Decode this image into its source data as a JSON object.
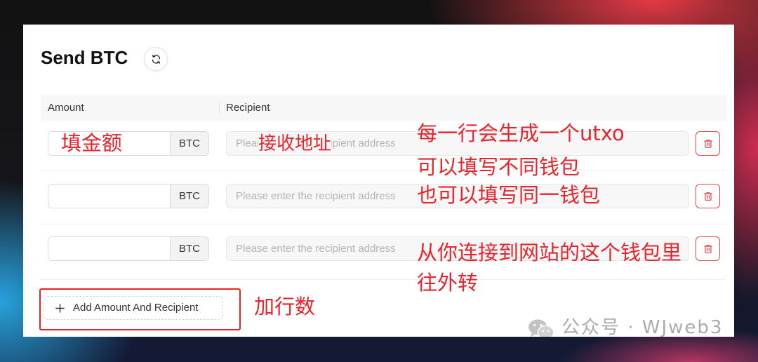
{
  "header": {
    "title": "Send BTC",
    "refresh_icon": "refresh-icon"
  },
  "table": {
    "columns": {
      "amount": "Amount",
      "recipient": "Recipient"
    },
    "rows": [
      {
        "currency": "BTC",
        "recipient_placeholder": "Please enter the recipient address"
      },
      {
        "currency": "BTC",
        "recipient_placeholder": "Please enter the recipient address"
      },
      {
        "currency": "BTC",
        "recipient_placeholder": "Please enter the recipient address"
      }
    ],
    "delete_icon": "trash-icon"
  },
  "add_button": {
    "label": "Add Amount And Recipient",
    "icon": "plus-icon"
  },
  "annotations": {
    "amount": "填金额",
    "recipient": "接收地址",
    "note_line1": "每一行会生成一个utxo",
    "note_line2": "可以填写不同钱包",
    "note_line3": "也可以填写同一钱包",
    "source_line1": "从你连接到网站的这个钱包里",
    "source_line2": "往外转",
    "add_rows": "加行数"
  },
  "watermark": {
    "text": "公众号 · WJweb3",
    "icon": "wechat-icon"
  },
  "colors": {
    "annotation": "#e8232b",
    "delete": "#e5484d",
    "card_background": "#ffffff",
    "header_background": "#f7f7f8"
  }
}
